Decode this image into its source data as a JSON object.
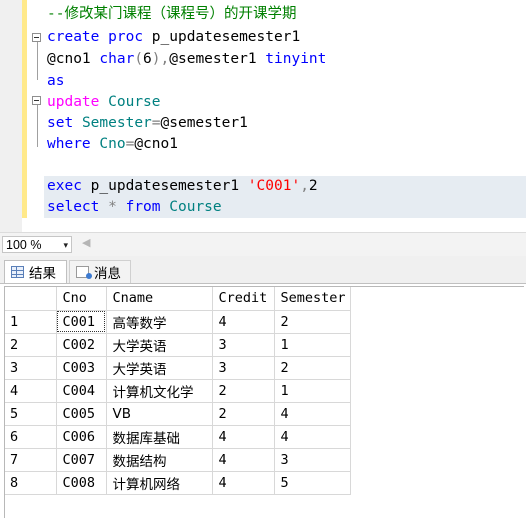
{
  "editor": {
    "lines": [
      [
        {
          "t": "--修改某门课程（课程号）的开课学期",
          "c": "cm"
        }
      ],
      [
        {
          "t": "create",
          "c": "kw"
        },
        {
          "t": " ",
          "c": "tx"
        },
        {
          "t": "proc",
          "c": "kw"
        },
        {
          "t": " p_updatesemester1",
          "c": "tx"
        }
      ],
      [
        {
          "t": "@cno1 ",
          "c": "tx"
        },
        {
          "t": "char",
          "c": "kw"
        },
        {
          "t": "(",
          "c": "op"
        },
        {
          "t": "6",
          "c": "tx"
        },
        {
          "t": "),",
          "c": "op"
        },
        {
          "t": "@semester1 ",
          "c": "tx"
        },
        {
          "t": "tinyint",
          "c": "kw"
        }
      ],
      [
        {
          "t": "as",
          "c": "kw"
        }
      ],
      [
        {
          "t": "update",
          "c": "fn"
        },
        {
          "t": " ",
          "c": "tx"
        },
        {
          "t": "Course",
          "c": "tb"
        }
      ],
      [
        {
          "t": "set",
          "c": "kw"
        },
        {
          "t": " ",
          "c": "tx"
        },
        {
          "t": "Semester",
          "c": "tb"
        },
        {
          "t": "=",
          "c": "op"
        },
        {
          "t": "@semester1",
          "c": "tx"
        }
      ],
      [
        {
          "t": "where",
          "c": "kw"
        },
        {
          "t": " ",
          "c": "tx"
        },
        {
          "t": "Cno",
          "c": "tb"
        },
        {
          "t": "=",
          "c": "op"
        },
        {
          "t": "@cno1",
          "c": "tx"
        }
      ],
      [],
      [
        {
          "t": "exec",
          "c": "kw"
        },
        {
          "t": " p_updatesemester1 ",
          "c": "tx"
        },
        {
          "t": "'C001'",
          "c": "st"
        },
        {
          "t": ",",
          "c": "op"
        },
        {
          "t": "2",
          "c": "tx"
        }
      ],
      [
        {
          "t": "select",
          "c": "kw"
        },
        {
          "t": " ",
          "c": "tx"
        },
        {
          "t": "*",
          "c": "op"
        },
        {
          "t": " ",
          "c": "tx"
        },
        {
          "t": "from",
          "c": "kw"
        },
        {
          "t": " ",
          "c": "tx"
        },
        {
          "t": "Course",
          "c": "tb"
        }
      ]
    ]
  },
  "zoom": {
    "value": "100 %",
    "arrow": "▾"
  },
  "tabs": [
    {
      "label": "结果",
      "icon": "grid-icon"
    },
    {
      "label": "消息",
      "icon": "message-icon"
    }
  ],
  "results": {
    "columns": [
      "",
      "Cno",
      "Cname",
      "Credit",
      "Semester"
    ],
    "rows": [
      [
        "1",
        "C001",
        "高等数学",
        "4",
        "2"
      ],
      [
        "2",
        "C002",
        "大学英语",
        "3",
        "1"
      ],
      [
        "3",
        "C003",
        "大学英语",
        "3",
        "2"
      ],
      [
        "4",
        "C004",
        "计算机文化学",
        "2",
        "1"
      ],
      [
        "5",
        "C005",
        "VB",
        "2",
        "4"
      ],
      [
        "6",
        "C006",
        "数据库基础",
        "4",
        "4"
      ],
      [
        "7",
        "C007",
        "数据结构",
        "4",
        "3"
      ],
      [
        "8",
        "C008",
        "计算机网络",
        "4",
        "5"
      ]
    ]
  }
}
